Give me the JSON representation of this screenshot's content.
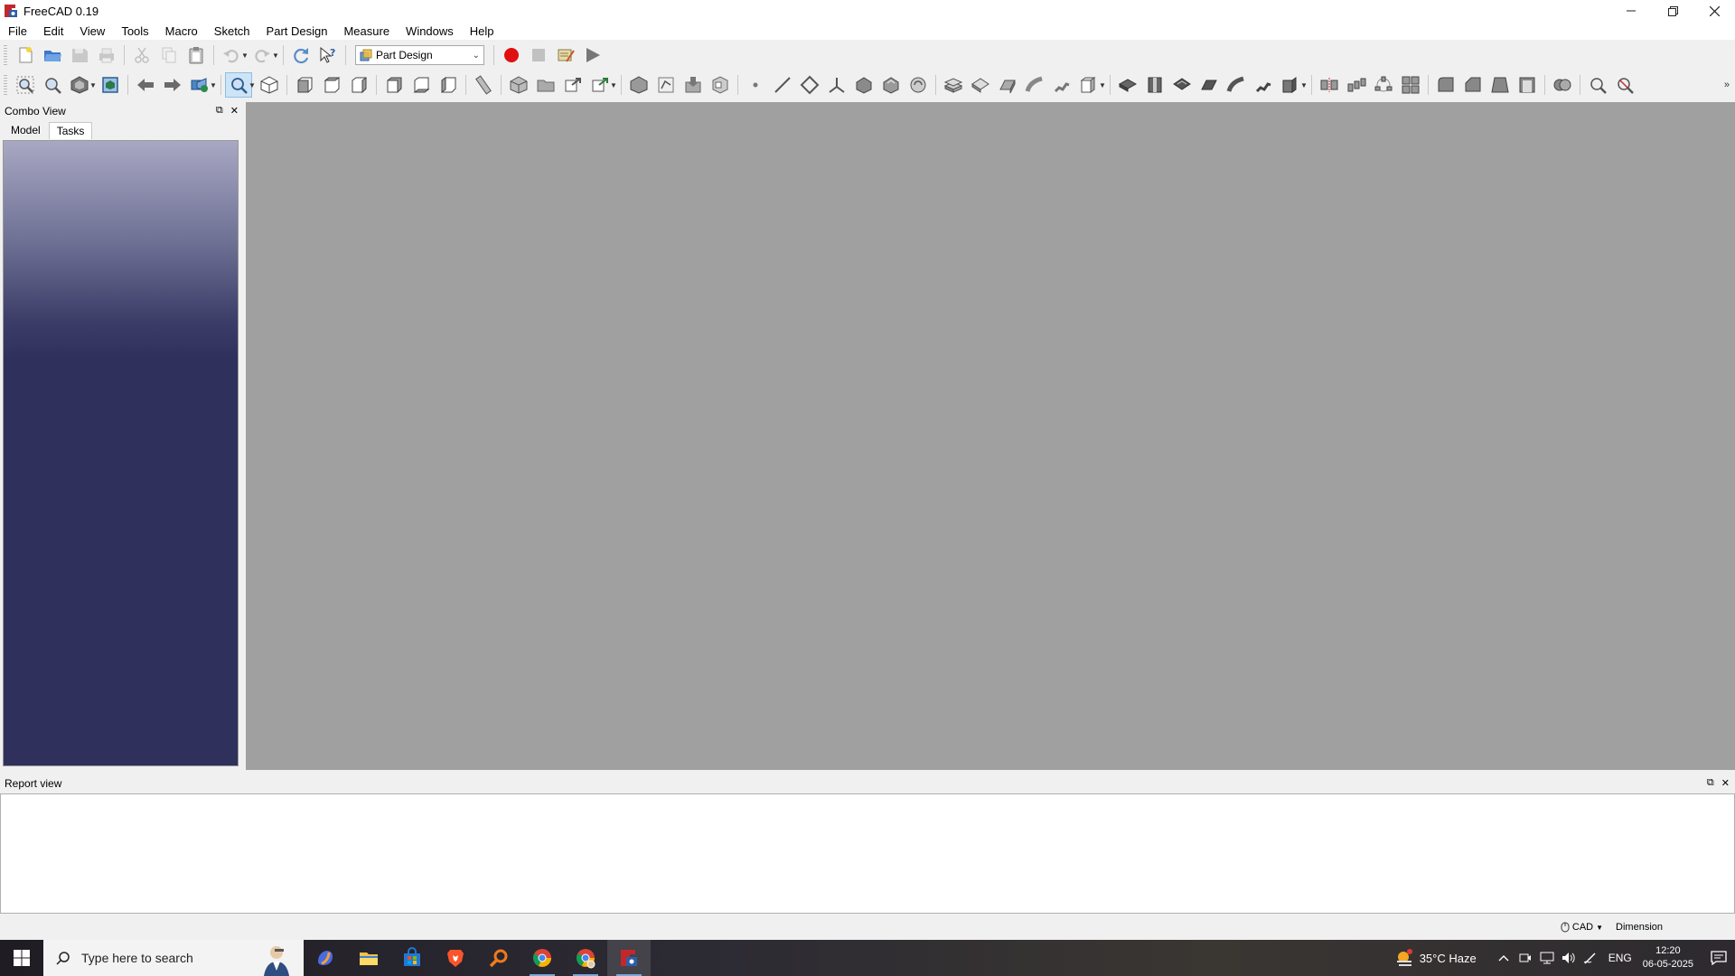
{
  "window": {
    "title": "FreeCAD 0.19"
  },
  "menu": [
    "File",
    "Edit",
    "View",
    "Tools",
    "Macro",
    "Sketch",
    "Part Design",
    "Measure",
    "Windows",
    "Help"
  ],
  "toolbar": {
    "workbench": "Part Design"
  },
  "combo_view": {
    "title": "Combo View",
    "tabs": [
      "Model",
      "Tasks"
    ],
    "selected_tab": "Tasks"
  },
  "report_view": {
    "title": "Report view"
  },
  "statusbar": {
    "nav_style": "CAD",
    "mode": "Dimension"
  },
  "taskbar": {
    "search_placeholder": "Type here to search",
    "weather": "35°C  Haze",
    "language": "ENG",
    "time": "12:20",
    "date": "06-05-2025"
  },
  "colors": {
    "viewport": "#a0a0a0",
    "tree_bg_top": "#a8a8c3",
    "tree_bg_bottom": "#30305c",
    "record_red": "#e01010"
  }
}
